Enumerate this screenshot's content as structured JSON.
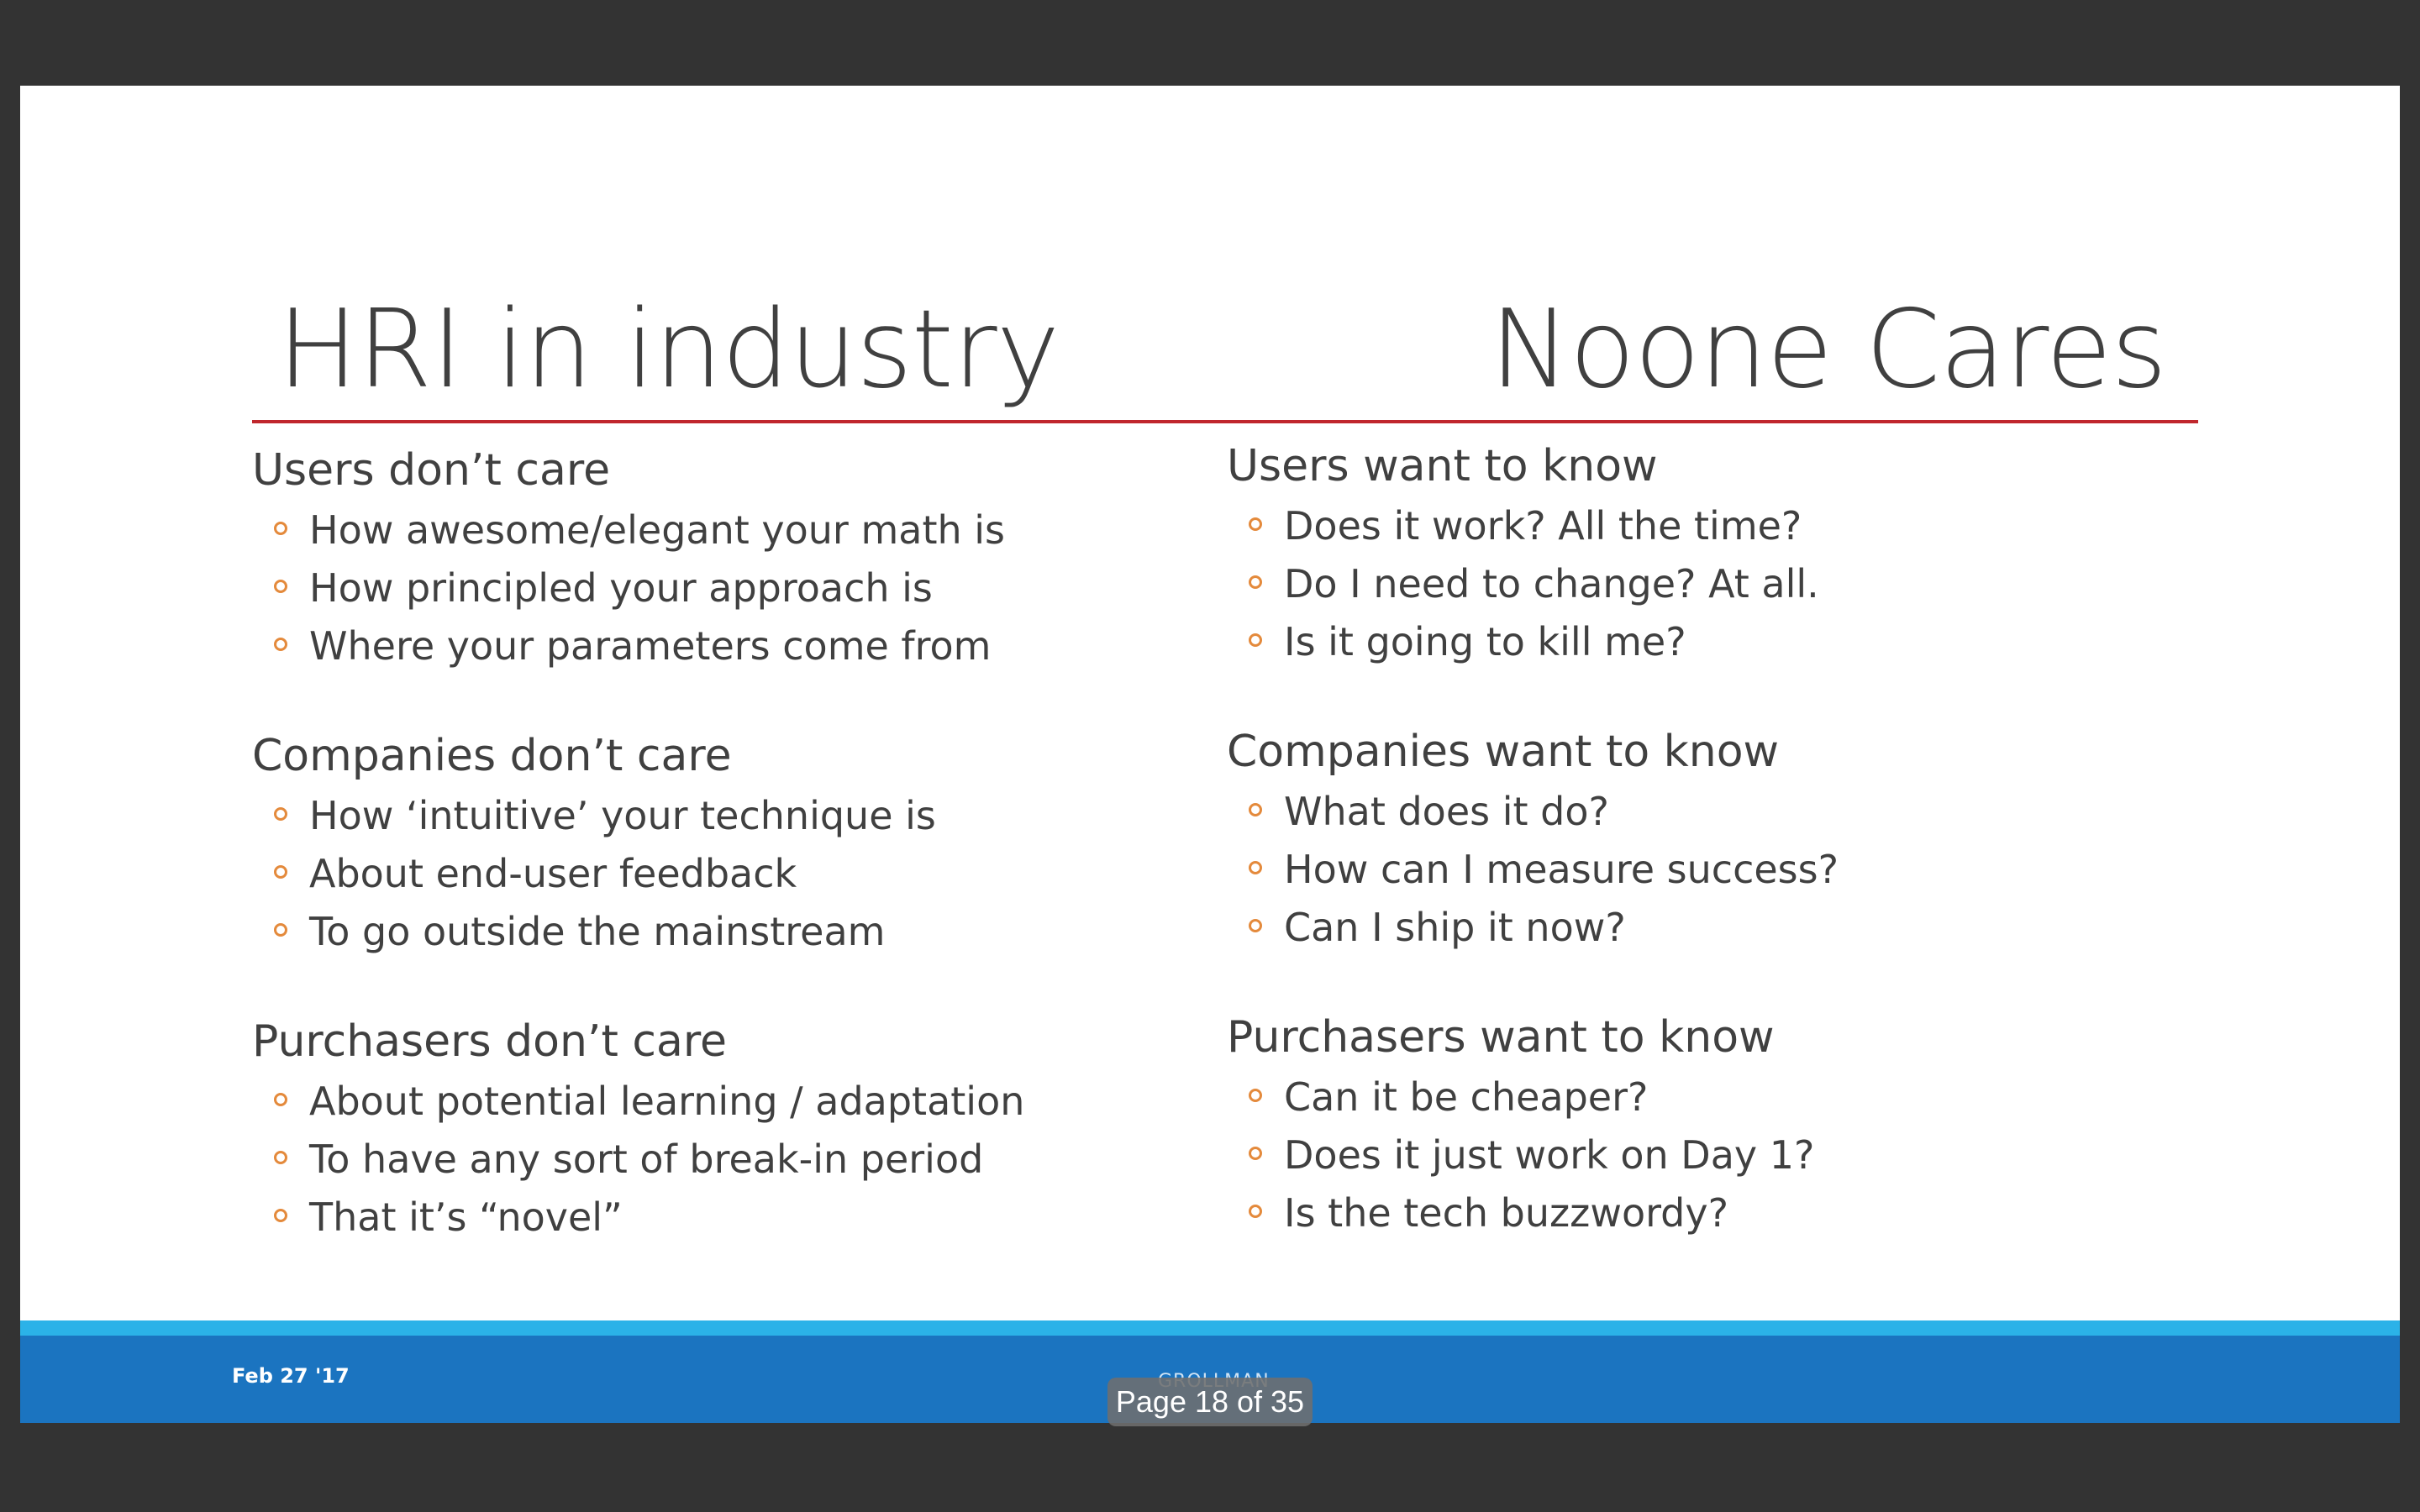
{
  "slide": {
    "title_left": "HRI in industry",
    "title_right": "Noone Cares",
    "left_column": [
      {
        "heading": "Users don’t care",
        "bullets": [
          "How awesome/elegant your math is",
          "How principled your approach is",
          "Where your parameters come from"
        ]
      },
      {
        "heading": "Companies don’t care",
        "bullets": [
          "How ‘intuitive’ your technique is",
          "About end-user feedback",
          "To go outside the mainstream"
        ]
      },
      {
        "heading": "Purchasers don’t care",
        "bullets": [
          "About potential learning / adaptation",
          "To have any sort of break-in period",
          "That it’s “novel”"
        ]
      }
    ],
    "right_column": [
      {
        "heading": "Users want to know",
        "bullets": [
          "Does it work?  All the time?",
          "Do I need to change?  At all.",
          "Is it going to kill me?"
        ]
      },
      {
        "heading": "Companies want to know",
        "bullets": [
          "What does it do?",
          "How can I measure success?",
          "Can I ship it now?"
        ]
      },
      {
        "heading": "Purchasers want to know",
        "bullets": [
          "Can it be cheaper?",
          "Does it just work on Day 1?",
          "Is the tech buzzwordy?"
        ]
      }
    ],
    "footer_date": "Feb 27 '17",
    "footer_author": "GROLLMAN"
  },
  "viewer": {
    "page_indicator": "Page 18 of 35"
  },
  "colors": {
    "title_rule": "#c0272d",
    "bullet_marker": "#e48a3c",
    "footer_bar": "#1b74c0",
    "footer_accent": "#2bb2e8",
    "viewer_background": "#333333"
  }
}
